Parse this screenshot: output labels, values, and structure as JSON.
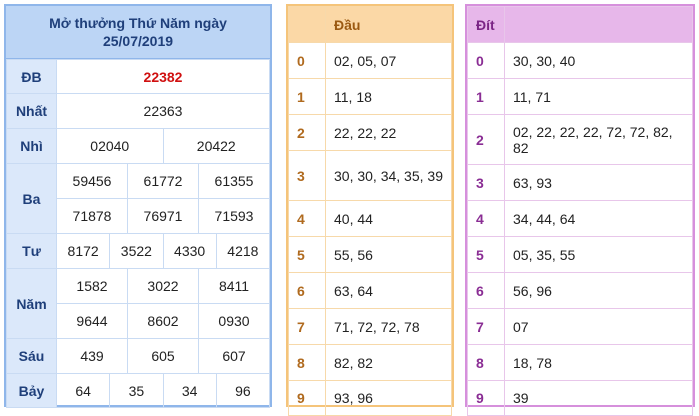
{
  "results": {
    "title": "Mở thưởng Thứ Năm ngày",
    "date": "25/07/2019",
    "prizes": [
      {
        "label": "ĐB",
        "numbers": [
          "22382"
        ]
      },
      {
        "label": "Nhất",
        "numbers": [
          "22363"
        ]
      },
      {
        "label": "Nhì",
        "numbers": [
          "02040",
          "20422"
        ]
      },
      {
        "label": "Ba",
        "numbers": [
          "59456",
          "61772",
          "61355",
          "71878",
          "76971",
          "71593"
        ]
      },
      {
        "label": "Tư",
        "numbers": [
          "8172",
          "3522",
          "4330",
          "4218"
        ]
      },
      {
        "label": "Năm",
        "numbers": [
          "1582",
          "3022",
          "8411",
          "9644",
          "8602",
          "0930"
        ]
      },
      {
        "label": "Sáu",
        "numbers": [
          "439",
          "605",
          "607"
        ]
      },
      {
        "label": "Bảy",
        "numbers": [
          "64",
          "35",
          "34",
          "96"
        ]
      }
    ]
  },
  "dau": {
    "header": "Đầu",
    "rows": [
      {
        "k": "0",
        "v": "02, 05, 07"
      },
      {
        "k": "1",
        "v": "11, 18"
      },
      {
        "k": "2",
        "v": "22, 22, 22"
      },
      {
        "k": "3",
        "v": "30, 30, 34, 35, 39"
      },
      {
        "k": "4",
        "v": "40, 44"
      },
      {
        "k": "5",
        "v": "55, 56"
      },
      {
        "k": "6",
        "v": "63, 64"
      },
      {
        "k": "7",
        "v": "71, 72, 72, 78"
      },
      {
        "k": "8",
        "v": "82, 82"
      },
      {
        "k": "9",
        "v": "93, 96"
      }
    ]
  },
  "dit": {
    "header": "Đít",
    "rows": [
      {
        "k": "0",
        "v": "30, 30, 40"
      },
      {
        "k": "1",
        "v": "11, 71"
      },
      {
        "k": "2",
        "v": "02, 22, 22, 22, 72, 72, 82, 82"
      },
      {
        "k": "3",
        "v": "63, 93"
      },
      {
        "k": "4",
        "v": "34, 44, 64"
      },
      {
        "k": "5",
        "v": "05, 35, 55"
      },
      {
        "k": "6",
        "v": "56, 96"
      },
      {
        "k": "7",
        "v": "07"
      },
      {
        "k": "8",
        "v": "18, 78"
      },
      {
        "k": "9",
        "v": "39"
      }
    ]
  }
}
